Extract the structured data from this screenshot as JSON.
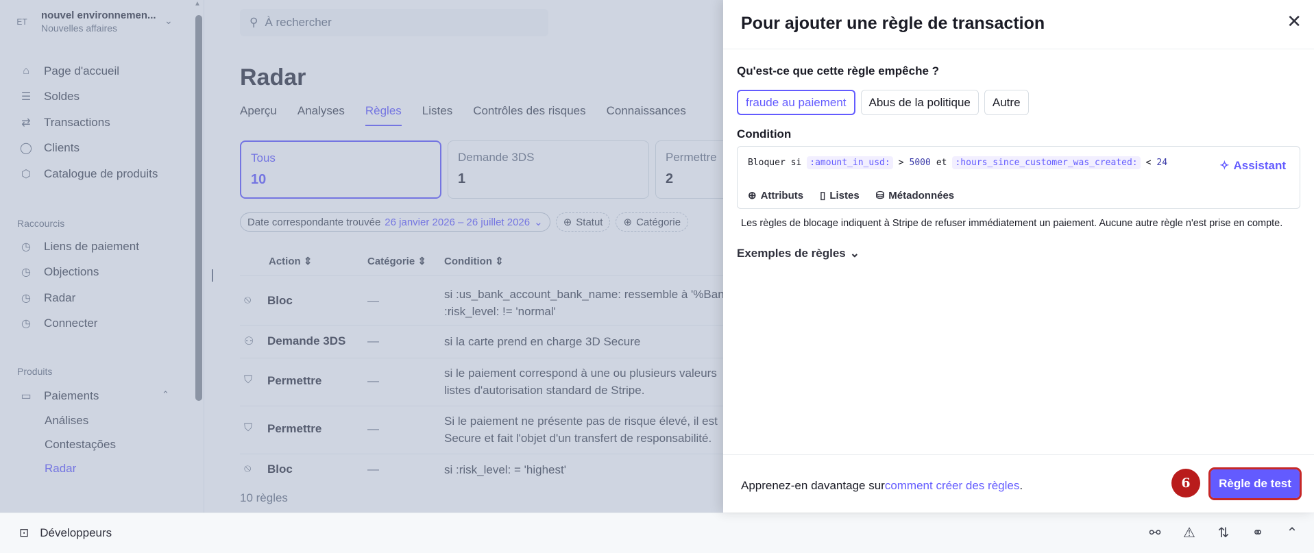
{
  "account": {
    "badge": "ET",
    "name": "nouvel environnemen...",
    "subtitle": "Nouvelles affaires"
  },
  "sidebar": {
    "items": [
      {
        "label": "Page d'accueil",
        "icon": "home-icon"
      },
      {
        "label": "Soldes",
        "icon": "balance-icon"
      },
      {
        "label": "Transactions",
        "icon": "transfer-icon"
      },
      {
        "label": "Clients",
        "icon": "user-icon"
      },
      {
        "label": "Catalogue de produits",
        "icon": "box-icon"
      }
    ],
    "shortcuts_label": "Raccourcis",
    "shortcuts": [
      {
        "label": "Liens de paiement",
        "icon": "clock-icon"
      },
      {
        "label": "Objections",
        "icon": "clock-icon"
      },
      {
        "label": "Radar",
        "icon": "clock-icon"
      },
      {
        "label": "Connecter",
        "icon": "clock-icon"
      }
    ],
    "products_label": "Produits",
    "payments_label": "Paiements",
    "payments_sub": [
      "Análises",
      "Contestações",
      "Radar"
    ]
  },
  "main": {
    "search_placeholder": "À rechercher",
    "title": "Radar",
    "tabs": [
      "Aperçu",
      "Analyses",
      "Règles",
      "Listes",
      "Contrôles des risques",
      "Connaissances"
    ],
    "active_tab": "Règles",
    "cards": [
      {
        "title": "Tous",
        "count": "10"
      },
      {
        "title": "Demande 3DS",
        "count": "1"
      },
      {
        "title": "Permettre",
        "count": "2"
      }
    ],
    "filters": {
      "date_label": "Date correspondante trouvée",
      "date_value": "26 janvier 2026 – 26 juillet 2026",
      "status": "Statut",
      "category": "Catégorie"
    },
    "columns": [
      "Action",
      "Catégorie",
      "Condition"
    ],
    "rows": [
      {
        "action": "Bloc",
        "category": "—",
        "condition_1": "si :us_bank_account_bank_name: ressemble à '%Bank",
        "condition_2": ":risk_level: != 'normal'"
      },
      {
        "action": "Demande 3DS",
        "category": "—",
        "condition_1": "si la carte prend en charge 3D Secure",
        "condition_2": ""
      },
      {
        "action": "Permettre",
        "category": "—",
        "condition_1": "si le paiement correspond à une ou plusieurs valeurs",
        "condition_2": "listes d'autorisation standard de Stripe."
      },
      {
        "action": "Permettre",
        "category": "—",
        "condition_1": "Si le paiement ne présente pas de risque élevé, il est",
        "condition_2": "Secure et fait l'objet d'un transfert de responsabilité."
      },
      {
        "action": "Bloc",
        "category": "—",
        "condition_1": "si :risk_level: = 'highest'",
        "condition_2": ""
      }
    ],
    "rules_count": "10 règles"
  },
  "panel": {
    "title": "Pour ajouter une règle de transaction",
    "question": "Qu'est-ce que cette règle empêche ?",
    "choices": [
      "fraude au paiement",
      "Abus de la politique",
      "Autre"
    ],
    "selected_choice": "fraude au paiement",
    "condition_label": "Condition",
    "condition": {
      "prefix": "Bloquer si",
      "attr1": ":amount_in_usd:",
      "op1": ">",
      "val1": "5000",
      "joiner": "et",
      "attr2": ":hours_since_customer_was_created:",
      "op2": "<",
      "val2": "24"
    },
    "assistant_label": "Assistant",
    "tools": [
      "Attributs",
      "Listes",
      "Métadonnées"
    ],
    "hint": "Les règles de blocage indiquent à Stripe de refuser immédiatement un paiement. Aucune autre règle n'est prise en compte.",
    "examples_label": "Exemples de règles",
    "learn_prefix": "Apprenez-en davantage sur",
    "learn_link": "comment créer des règles",
    "learn_suffix": ".",
    "step_number": "6",
    "test_button": "Règle de test"
  },
  "devbar": {
    "label": "Développeurs"
  },
  "colors": {
    "accent": "#635bff",
    "step_badge": "#b91c1c",
    "overlay": "#8d9ab8"
  }
}
